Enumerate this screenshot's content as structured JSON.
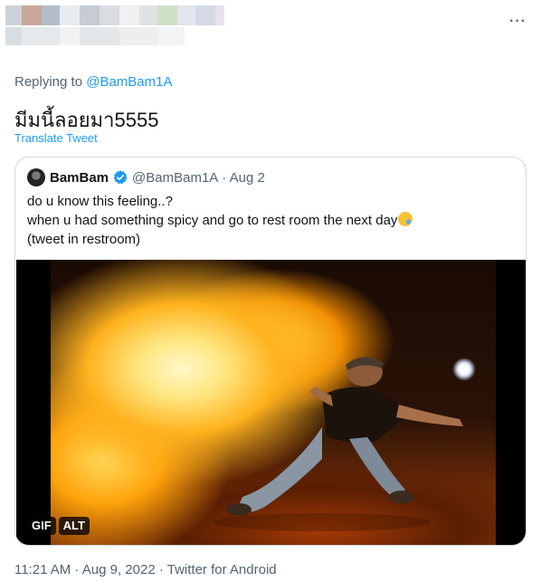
{
  "tweet": {
    "reply_prefix": "Replying to",
    "reply_handle": "@BamBam1A",
    "text": "มีมนี้ลอยมา5555",
    "translate_label": "Translate Tweet",
    "more_icon": "more-horizontal-icon",
    "timestamp": "11:21 AM · Aug 9, 2022 · Twitter for Android"
  },
  "quoted": {
    "name": "BamBam",
    "handle": "@BamBam1A",
    "date": "· Aug 2",
    "verified_color": "#1d9bf0",
    "lines": [
      "do u know this feeling..?",
      "when u had something spicy and go to rest room the next day",
      "(tweet in restroom)"
    ],
    "media_badges": [
      "GIF",
      "ALT"
    ]
  }
}
